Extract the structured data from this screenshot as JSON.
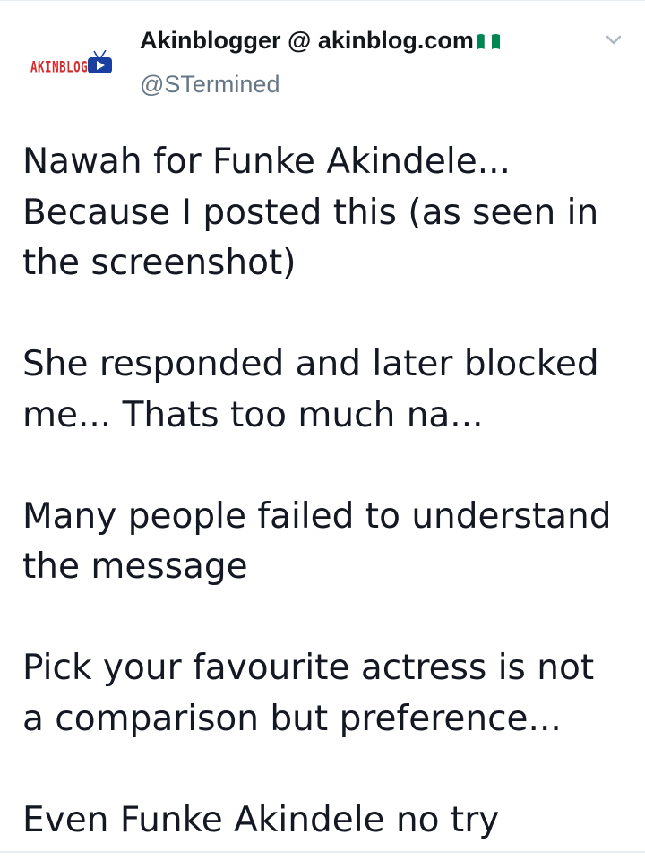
{
  "tweet": {
    "avatar": {
      "logo_text": "AKINBLOG",
      "icon": "tv-play-icon"
    },
    "display_name": "Akinblogger @ akinblog.com",
    "flag_icon": "nigeria-flag-icon",
    "handle": "@STermined",
    "menu_icon": "chevron-down-icon",
    "paragraphs": [
      "Nawah for Funke Akindele...\nBecause I posted this (as seen in\nthe screenshot)",
      "She responded and later blocked\nme... Thats too much na...",
      "Many people failed to understand\nthe message",
      "Pick your favourite actress is not\na comparison but preference...",
      "Even Funke Akindele no try"
    ],
    "colors": {
      "logo_red": "#d62b2b",
      "logo_blue": "#1a3fa0",
      "flag_green": "#008751",
      "handle_gray": "#657786",
      "text": "#141823"
    }
  }
}
